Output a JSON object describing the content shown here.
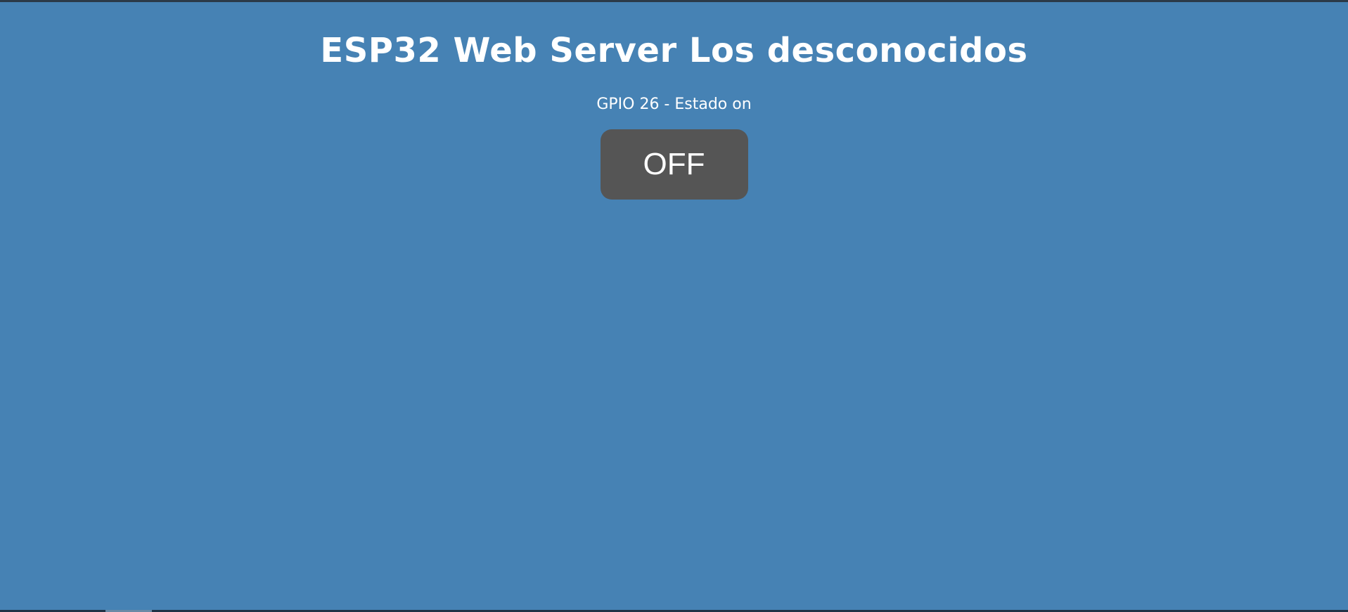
{
  "page": {
    "title": "ESP32 Web Server Los desconocidos",
    "status_text": "GPIO 26 - Estado on",
    "toggle_button_label": "OFF"
  },
  "colors": {
    "background": "#4682b4",
    "button": "#555555",
    "text": "#ffffff"
  }
}
